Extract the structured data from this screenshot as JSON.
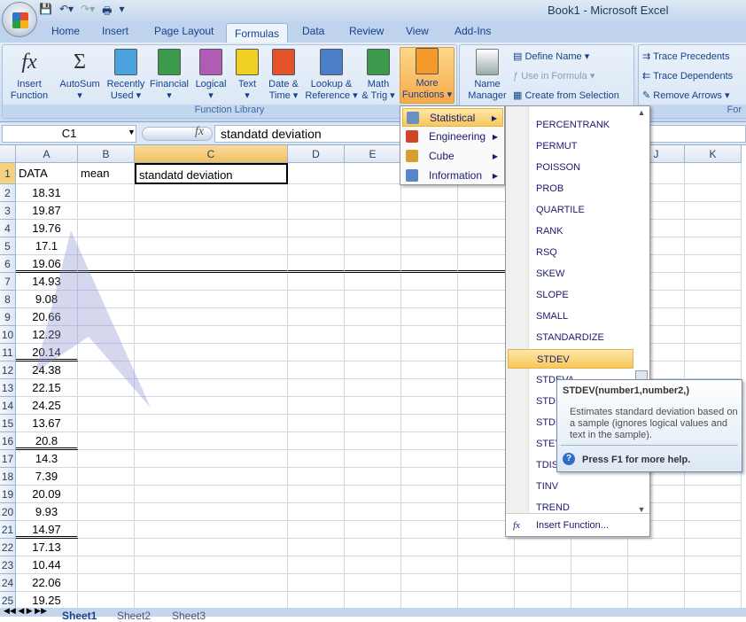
{
  "window": {
    "title": "Book1 - Microsoft Excel"
  },
  "tabs": [
    "Home",
    "Insert",
    "Page Layout",
    "Formulas",
    "Data",
    "Review",
    "View",
    "Add-Ins"
  ],
  "active_tab": "Formulas",
  "ribbon": {
    "function_library": {
      "label": "Function Library",
      "buttons": [
        {
          "l1": "Insert",
          "l2": "Function",
          "icon": "fx-icon"
        },
        {
          "l1": "AutoSum",
          "l2": "▾",
          "icon": "sigma-icon"
        },
        {
          "l1": "Recently",
          "l2": "Used ▾",
          "icon": "book-star-icon"
        },
        {
          "l1": "Financial",
          "l2": "▾",
          "icon": "book-financial-icon"
        },
        {
          "l1": "Logical",
          "l2": "▾",
          "icon": "book-question-icon"
        },
        {
          "l1": "Text",
          "l2": "▾",
          "icon": "book-text-icon"
        },
        {
          "l1": "Date &",
          "l2": "Time ▾",
          "icon": "book-calendar-icon"
        },
        {
          "l1": "Lookup &",
          "l2": "Reference ▾",
          "icon": "book-magnifier-icon"
        },
        {
          "l1": "Math",
          "l2": "& Trig ▾",
          "icon": "book-theta-icon"
        },
        {
          "l1": "More",
          "l2": "Functions ▾",
          "icon": "books-icon"
        }
      ]
    },
    "defined_names": {
      "name_manager": [
        "Name",
        "Manager"
      ],
      "define_name": "Define Name ▾",
      "use_in_formula": "Use in Formula ▾",
      "create_from_selection": "Create from Selection"
    },
    "formula_auditing": {
      "trace_precedents": "Trace Precedents",
      "trace_dependents": "Trace Dependents",
      "remove_arrows": "Remove Arrows ▾",
      "group_label_partial": "For"
    }
  },
  "formula_bar": {
    "name_box": "C1",
    "fx": "fx",
    "value": "standatd deviation"
  },
  "columns": [
    "A",
    "B",
    "C",
    "D",
    "E",
    "F",
    "G",
    "H",
    "I",
    "J",
    "K"
  ],
  "rows": [
    {
      "n": "1",
      "a": "DATA",
      "b": "mean",
      "c": "standatd deviation"
    },
    {
      "n": "2",
      "a": "18.31"
    },
    {
      "n": "3",
      "a": "19.87"
    },
    {
      "n": "4",
      "a": "19.76"
    },
    {
      "n": "5",
      "a": "17.1"
    },
    {
      "n": "6",
      "a": "19.06"
    },
    {
      "n": "7",
      "a": "14.93"
    },
    {
      "n": "8",
      "a": "9.08"
    },
    {
      "n": "9",
      "a": "20.66"
    },
    {
      "n": "10",
      "a": "12.29"
    },
    {
      "n": "11",
      "a": "20.14"
    },
    {
      "n": "12",
      "a": "24.38"
    },
    {
      "n": "13",
      "a": "22.15"
    },
    {
      "n": "14",
      "a": "24.25"
    },
    {
      "n": "15",
      "a": "13.67"
    },
    {
      "n": "16",
      "a": "20.8"
    },
    {
      "n": "17",
      "a": "14.3"
    },
    {
      "n": "18",
      "a": "7.39"
    },
    {
      "n": "19",
      "a": "20.09"
    },
    {
      "n": "20",
      "a": "9.93"
    },
    {
      "n": "21",
      "a": "14.97"
    },
    {
      "n": "22",
      "a": "17.13"
    },
    {
      "n": "23",
      "a": "10.44"
    },
    {
      "n": "24",
      "a": "22.06"
    },
    {
      "n": "25",
      "a": "19.25"
    }
  ],
  "sheet_tabs": [
    "Sheet1",
    "Sheet2",
    "Sheet3"
  ],
  "more_functions_menu": [
    {
      "label": "Statistical",
      "icon": "statistical-icon",
      "highlighted": true
    },
    {
      "label": "Engineering",
      "icon": "engineering-icon"
    },
    {
      "label": "Cube",
      "icon": "cube-icon"
    },
    {
      "label": "Information",
      "icon": "information-icon"
    }
  ],
  "statistical_list": [
    "PERCENTRANK",
    "PERMUT",
    "POISSON",
    "PROB",
    "QUARTILE",
    "RANK",
    "RSQ",
    "SKEW",
    "SLOPE",
    "SMALL",
    "STANDARDIZE",
    "STDEV",
    "STDEVA",
    "STDEVP",
    "STDEVPA",
    "STEYX",
    "TDIST",
    "TINV",
    "TREND"
  ],
  "statistical_selected": "STDEV",
  "insert_function": "Insert Function...",
  "tooltip": {
    "signature": "STDEV(number1,number2,)",
    "description": "Estimates standard deviation based on a sample (ignores logical values and text in the sample).",
    "help": "Press F1 for more help."
  }
}
